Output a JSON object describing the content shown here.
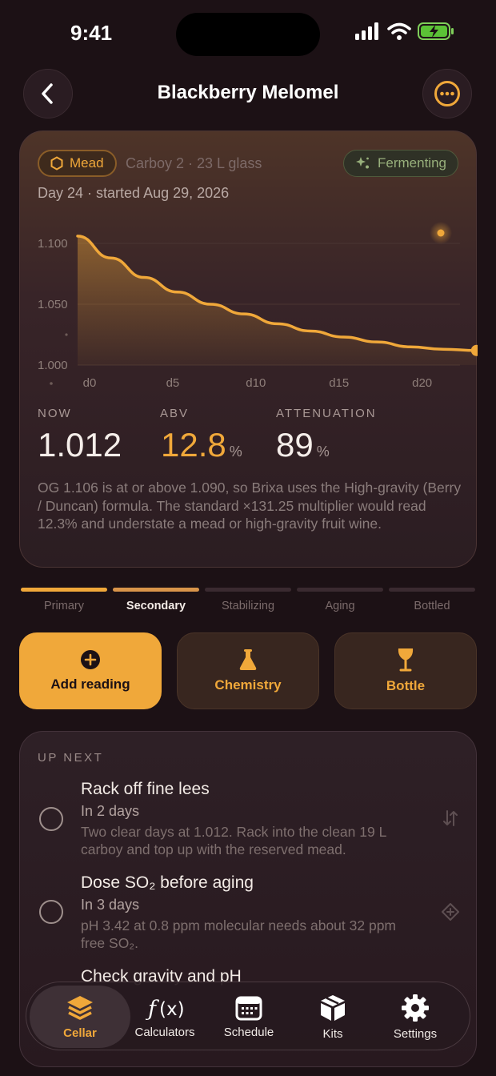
{
  "status_bar": {
    "time": "9:41"
  },
  "nav": {
    "title": "Blackberry Melomel"
  },
  "batch": {
    "type_chip": "Mead",
    "vessel": "Carboy 2 · 23 L glass",
    "status_chip": "Fermenting",
    "day_line": "Day 24 · started Aug 29, 2026",
    "stats": {
      "now_label": "NOW",
      "now_value": "1.012",
      "abv_label": "ABV",
      "abv_value": "12.8",
      "abv_unit": "%",
      "att_label": "ATTENUATION",
      "att_value": "89",
      "att_unit": "%"
    },
    "explanation": "OG 1.106 is at or above 1.090, so Brixa uses the High-gravity (Berry / Duncan) formula. The standard ×131.25 multiplier would read 12.3% and understate a mead or high-gravity fruit wine."
  },
  "chart_data": {
    "type": "area",
    "x_ticks": [
      "d0",
      "d5",
      "d10",
      "d15",
      "d20"
    ],
    "y_ticks": [
      "1.100",
      "1.050",
      "1.000"
    ],
    "ylim": [
      1.0,
      1.1
    ],
    "xlim": [
      0,
      23
    ],
    "series": [
      {
        "x": [
          0,
          2,
          4,
          6,
          8,
          10,
          12,
          14,
          16,
          18,
          20,
          22,
          24
        ],
        "y": [
          1.106,
          1.088,
          1.072,
          1.06,
          1.05,
          1.042,
          1.034,
          1.028,
          1.023,
          1.019,
          1.015,
          1.013,
          1.012
        ]
      }
    ],
    "colors": {
      "line": "#f0a83a",
      "grid": "#4a3532"
    }
  },
  "stages": [
    {
      "label": "Primary",
      "state": "done"
    },
    {
      "label": "Secondary",
      "state": "current"
    },
    {
      "label": "Stabilizing",
      "state": "todo"
    },
    {
      "label": "Aging",
      "state": "todo"
    },
    {
      "label": "Bottled",
      "state": "todo"
    }
  ],
  "actions": {
    "add_reading": "Add reading",
    "chemistry": "Chemistry",
    "bottle": "Bottle"
  },
  "upnext": {
    "heading": "UP NEXT",
    "tasks": [
      {
        "title": "Rack off fine lees",
        "when": "In 2 days",
        "desc": "Two clear days at 1.012. Rack into the clean 19 L carboy and top up with the reserved mead.",
        "icon": "transfer-icon"
      },
      {
        "title": "Dose SO₂ before aging",
        "when": "In 3 days",
        "desc": "pH 3.42 at 0.8 ppm molecular needs about 32 ppm free SO₂.",
        "icon": "diamond-plus-icon"
      },
      {
        "title": "Check gravity and pH",
        "when": "",
        "desc": "",
        "icon": ""
      }
    ]
  },
  "tabbar": {
    "tabs": [
      {
        "label": "Cellar",
        "icon": "layers-icon"
      },
      {
        "label": "Calculators",
        "icon": "function-icon"
      },
      {
        "label": "Schedule",
        "icon": "calendar-icon"
      },
      {
        "label": "Kits",
        "icon": "box-icon"
      },
      {
        "label": "Settings",
        "icon": "gear-icon"
      }
    ],
    "active": "Cellar"
  },
  "colors": {
    "accent": "#f0a83a",
    "background": "#1c1115",
    "status_green": "#98b07c"
  }
}
